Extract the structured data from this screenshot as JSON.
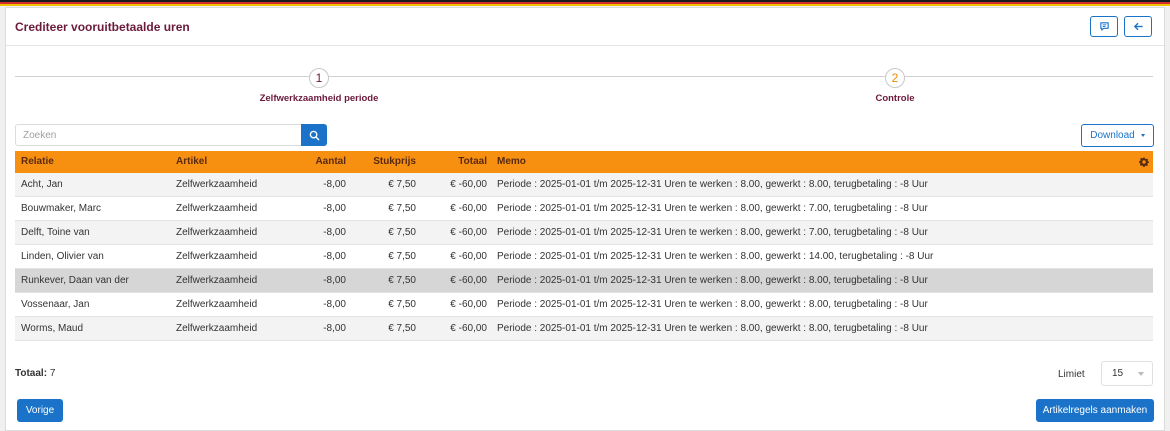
{
  "page": {
    "title": "Crediteer vooruitbetaalde uren"
  },
  "steps": [
    {
      "number": "1",
      "label": "Zelfwerkzaamheid periode"
    },
    {
      "number": "2",
      "label": "Controle"
    }
  ],
  "search": {
    "placeholder": "Zoeken",
    "value": ""
  },
  "toolbar": {
    "download_label": "Download"
  },
  "table": {
    "columns": [
      "Relatie",
      "Artikel",
      "Aantal",
      "Stukprijs",
      "Totaal",
      "Memo"
    ],
    "rows": [
      {
        "relatie": "Acht, Jan",
        "artikel": "Zelfwerkzaamheid",
        "aantal": "-8,00",
        "stukprijs": "€ 7,50",
        "totaal": "€ -60,00",
        "memo": "Periode : 2025-01-01 t/m 2025-12-31 Uren te werken : 8.00, gewerkt : 8.00, terugbetaling : -8 Uur"
      },
      {
        "relatie": "Bouwmaker, Marc",
        "artikel": "Zelfwerkzaamheid",
        "aantal": "-8,00",
        "stukprijs": "€ 7,50",
        "totaal": "€ -60,00",
        "memo": "Periode : 2025-01-01 t/m 2025-12-31 Uren te werken : 8.00, gewerkt : 7.00, terugbetaling : -8 Uur"
      },
      {
        "relatie": "Delft, Toine van",
        "artikel": "Zelfwerkzaamheid",
        "aantal": "-8,00",
        "stukprijs": "€ 7,50",
        "totaal": "€ -60,00",
        "memo": "Periode : 2025-01-01 t/m 2025-12-31 Uren te werken : 8.00, gewerkt : 7.00, terugbetaling : -8 Uur"
      },
      {
        "relatie": "Linden, Olivier van",
        "artikel": "Zelfwerkzaamheid",
        "aantal": "-8,00",
        "stukprijs": "€ 7,50",
        "totaal": "€ -60,00",
        "memo": "Periode : 2025-01-01 t/m 2025-12-31 Uren te werken : 8.00, gewerkt : 14.00, terugbetaling : -8 Uur"
      },
      {
        "relatie": "Runkever, Daan van der",
        "artikel": "Zelfwerkzaamheid",
        "aantal": "-8,00",
        "stukprijs": "€ 7,50",
        "totaal": "€ -60,00",
        "memo": "Periode : 2025-01-01 t/m 2025-12-31 Uren te werken : 8.00, gewerkt : 8.00, terugbetaling : -8 Uur"
      },
      {
        "relatie": "Vossenaar, Jan",
        "artikel": "Zelfwerkzaamheid",
        "aantal": "-8,00",
        "stukprijs": "€ 7,50",
        "totaal": "€ -60,00",
        "memo": "Periode : 2025-01-01 t/m 2025-12-31 Uren te werken : 8.00, gewerkt : 8.00, terugbetaling : -8 Uur"
      },
      {
        "relatie": "Worms, Maud",
        "artikel": "Zelfwerkzaamheid",
        "aantal": "-8,00",
        "stukprijs": "€ 7,50",
        "totaal": "€ -60,00",
        "memo": "Periode : 2025-01-01 t/m 2025-12-31 Uren te werken : 8.00, gewerkt : 8.00, terugbetaling : -8 Uur"
      }
    ]
  },
  "footer": {
    "totaal_label": "Totaal:",
    "totaal_value": "7",
    "limiet_label": "Limiet",
    "limiet_value": "15",
    "prev_label": "Vorige",
    "create_label": "Artikelregels aanmaken"
  },
  "icons": {
    "header_left": "feedback-icon",
    "header_right": "arrow-left-icon",
    "search": "search-icon",
    "settings": "gear-icon"
  },
  "colors": {
    "title": "#6b1a3a",
    "accent": "#1a73c8",
    "table_header": "#f79010",
    "step2": "#f38a00"
  }
}
